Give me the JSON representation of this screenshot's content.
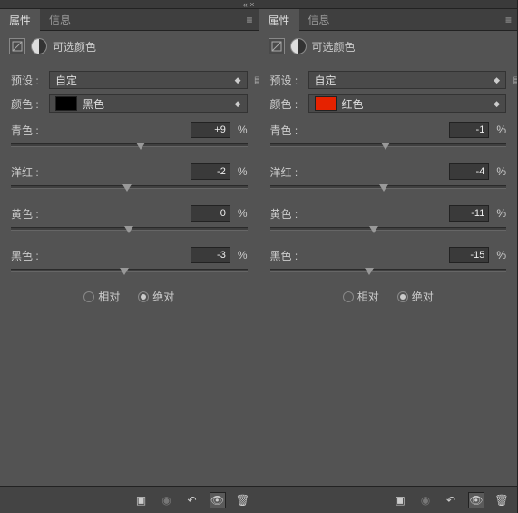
{
  "tabs": {
    "properties": "属性",
    "info": "信息"
  },
  "section_title": "可选颜色",
  "preset": {
    "label": "预设 :",
    "value": "自定"
  },
  "colors_label": "颜色 :",
  "percent": "%",
  "slider_labels": {
    "cyan": "青色 :",
    "magenta": "洋红 :",
    "yellow": "黄色 :",
    "black": "黑色 :"
  },
  "radios": {
    "relative": "相对",
    "absolute": "绝对"
  },
  "panels": [
    {
      "color_name": "黑色",
      "swatch": "#000000",
      "values": {
        "cyan": "+9",
        "magenta": "-2",
        "yellow": "0",
        "black": "-3"
      },
      "positions": {
        "cyan": 55,
        "magenta": 49,
        "yellow": 50,
        "black": 48
      },
      "selected_radio": "absolute"
    },
    {
      "color_name": "红色",
      "swatch": "#e62200",
      "values": {
        "cyan": "-1",
        "magenta": "-4",
        "yellow": "-11",
        "black": "-15"
      },
      "positions": {
        "cyan": 49,
        "magenta": 48,
        "yellow": 44,
        "black": 42
      },
      "selected_radio": "absolute"
    }
  ]
}
